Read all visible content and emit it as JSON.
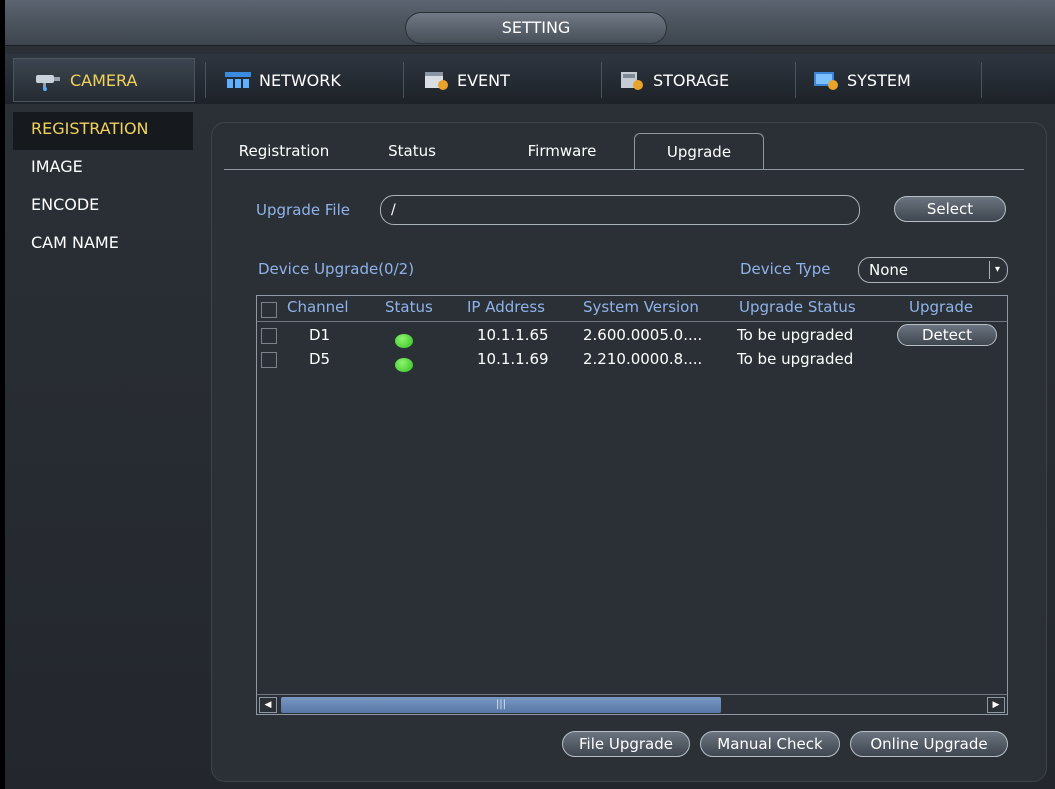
{
  "window": {
    "title": "SETTING"
  },
  "topnav": {
    "camera": {
      "label": "CAMERA",
      "icon": "camera-icon"
    },
    "items": [
      {
        "label": "NETWORK",
        "icon": "network-icon"
      },
      {
        "label": "EVENT",
        "icon": "event-icon"
      },
      {
        "label": "STORAGE",
        "icon": "storage-icon"
      },
      {
        "label": "SYSTEM",
        "icon": "system-icon"
      }
    ]
  },
  "sidebar": {
    "items": [
      {
        "label": "REGISTRATION",
        "active": true
      },
      {
        "label": "IMAGE"
      },
      {
        "label": "ENCODE"
      },
      {
        "label": "CAM NAME"
      }
    ]
  },
  "tabs": [
    {
      "label": "Registration"
    },
    {
      "label": "Status"
    },
    {
      "label": "Firmware"
    },
    {
      "label": "Upgrade",
      "active": true
    }
  ],
  "upgrade": {
    "file_label": "Upgrade File",
    "file_value": "/",
    "select_label": "Select",
    "device_upgrade_label": "Device Upgrade(0/2)",
    "device_type_label": "Device Type",
    "device_type_value": "None"
  },
  "table": {
    "headers": [
      "Channel",
      "Status",
      "IP Address",
      "System Version",
      "Upgrade Status",
      "Upgrade"
    ],
    "rows": [
      {
        "channel": "D1",
        "status": "online",
        "ip": "10.1.1.65",
        "version": "2.600.0005.0....",
        "upgrade_status": "To be upgraded",
        "action": "Detect"
      },
      {
        "channel": "D5",
        "status": "online",
        "ip": "10.1.1.69",
        "version": "2.210.0000.8....",
        "upgrade_status": "To be upgraded"
      }
    ]
  },
  "buttons": {
    "file_upgrade": "File Upgrade",
    "manual_check": "Manual Check",
    "online_upgrade": "Online Upgrade"
  },
  "colors": {
    "accent_yellow": "#f2d25a",
    "label_blue": "#8fb3e8",
    "status_green": "#3fd12b"
  }
}
